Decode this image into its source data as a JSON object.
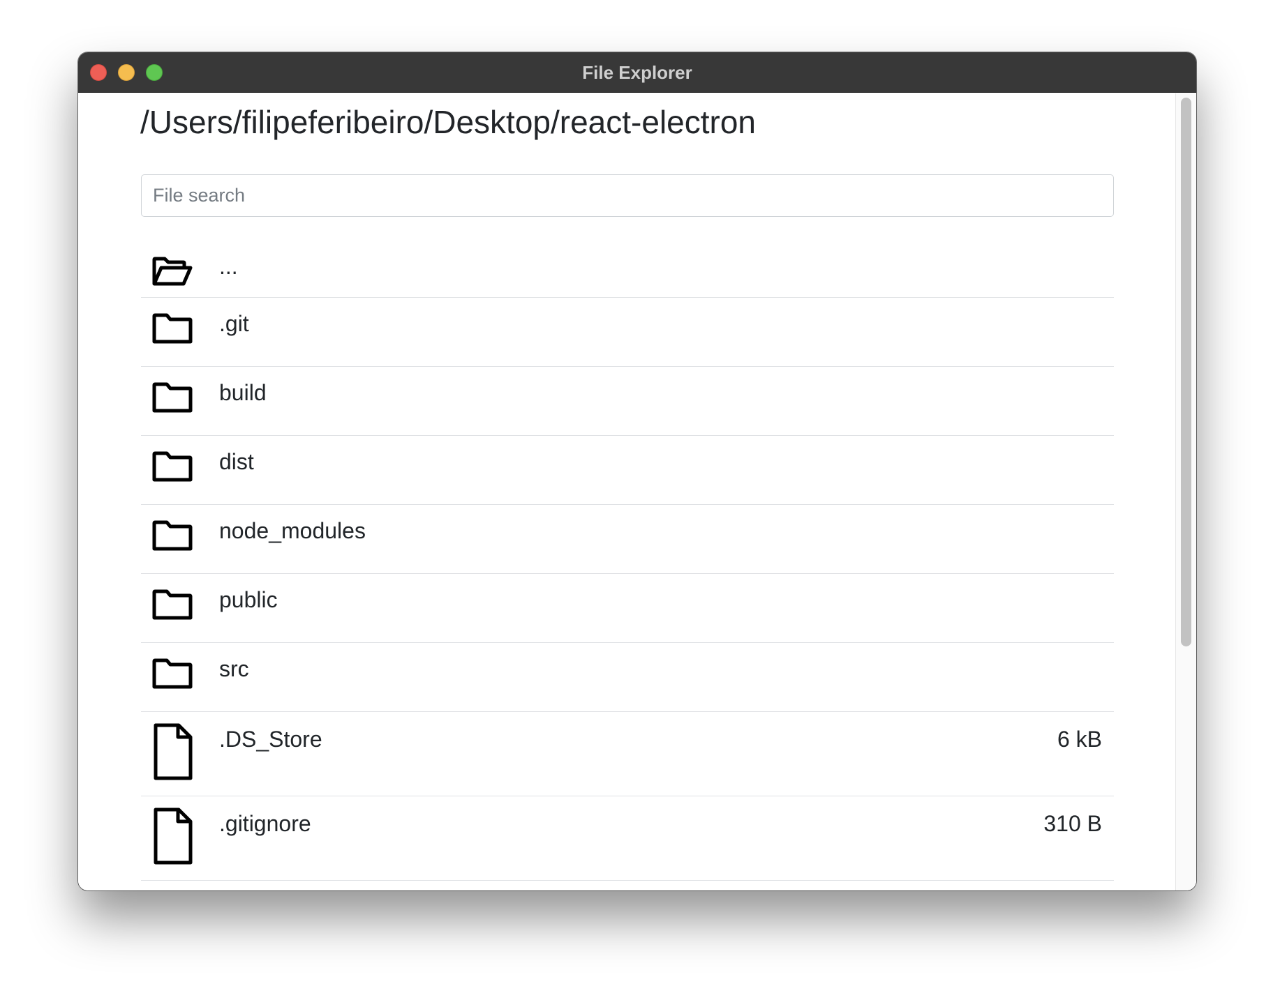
{
  "window": {
    "title": "File Explorer"
  },
  "path": "/Users/filipeferibeiro/Desktop/react-electron",
  "search": {
    "placeholder": "File search",
    "value": ""
  },
  "entries": [
    {
      "type": "parent",
      "icon": "folder-open-icon",
      "name": "..."
    },
    {
      "type": "folder",
      "icon": "folder-icon",
      "name": ".git"
    },
    {
      "type": "folder",
      "icon": "folder-icon",
      "name": "build"
    },
    {
      "type": "folder",
      "icon": "folder-icon",
      "name": "dist"
    },
    {
      "type": "folder",
      "icon": "folder-icon",
      "name": "node_modules"
    },
    {
      "type": "folder",
      "icon": "folder-icon",
      "name": "public"
    },
    {
      "type": "folder",
      "icon": "folder-icon",
      "name": "src"
    },
    {
      "type": "file",
      "icon": "file-icon",
      "name": ".DS_Store",
      "size": "6 kB"
    },
    {
      "type": "file",
      "icon": "file-icon",
      "name": ".gitignore",
      "size": "310 B"
    }
  ],
  "colors": {
    "titlebar": "#383838",
    "close": "#ee5f56",
    "minimize": "#f5bd4f",
    "maximize": "#5fc752",
    "text": "#212529",
    "divider": "#dfe1e4"
  }
}
